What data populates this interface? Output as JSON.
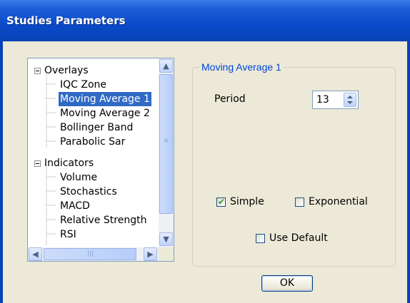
{
  "window": {
    "title": "Studies Parameters"
  },
  "tree": {
    "nodes": [
      {
        "label": "Overlays",
        "type": "group"
      },
      {
        "label": "IQC Zone",
        "type": "item"
      },
      {
        "label": "Moving Average 1",
        "type": "item",
        "selected": true
      },
      {
        "label": "Moving Average 2",
        "type": "item"
      },
      {
        "label": "Bollinger Band",
        "type": "item"
      },
      {
        "label": "Parabolic Sar",
        "type": "item"
      },
      {
        "label": "Indicators",
        "type": "group"
      },
      {
        "label": "Volume",
        "type": "item"
      },
      {
        "label": "Stochastics",
        "type": "item"
      },
      {
        "label": "MACD",
        "type": "item"
      },
      {
        "label": "Relative Strength",
        "type": "item"
      },
      {
        "label": "RSI",
        "type": "item"
      }
    ]
  },
  "params": {
    "group_title": "Moving Average 1",
    "period_label": "Period",
    "period_value": "13",
    "simple_label": "Simple",
    "simple_checked": true,
    "exponential_label": "Exponential",
    "exponential_checked": false,
    "use_default_label": "Use Default",
    "use_default_checked": false
  },
  "buttons": {
    "ok_label": "OK"
  },
  "colors": {
    "title_bar": "#0a49c9",
    "selection": "#316ac5",
    "group_title": "#0046d5",
    "check": "#21a121"
  },
  "icons": [
    "expand-minus-icon",
    "scroll-up-arrow-icon",
    "scroll-down-arrow-icon",
    "scroll-left-arrow-icon",
    "scroll-right-arrow-icon",
    "spin-up-icon",
    "spin-down-icon",
    "checkmark-icon"
  ]
}
